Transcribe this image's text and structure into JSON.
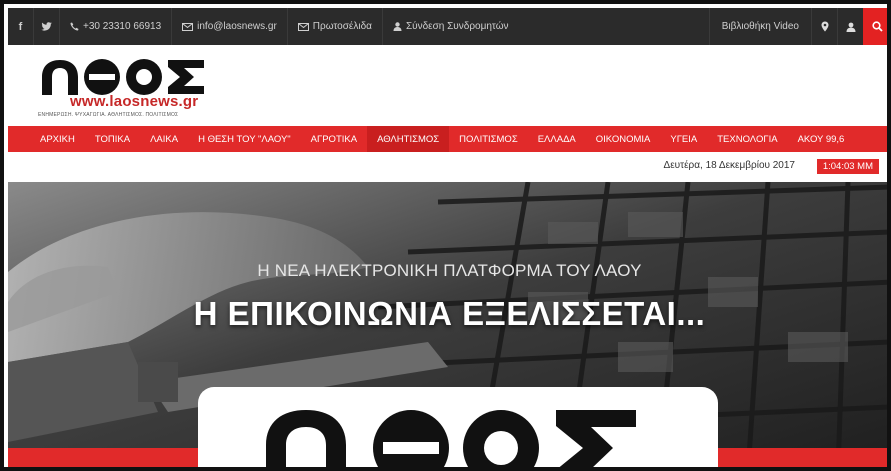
{
  "topbar": {
    "social": [
      {
        "icon": "facebook-icon",
        "glyph": "f"
      },
      {
        "icon": "twitter-icon",
        "glyph": "t"
      }
    ],
    "phone": "+30 23310 66913",
    "email": "info@laosnews.gr",
    "frontpages": "Πρωτοσέλιδα",
    "subscribers_login": "Σύνδεση Συνδρομητών",
    "video_library": "Βιβλιοθήκη Video"
  },
  "header": {
    "logo_text": "ΛΑΟΣ",
    "url": "www.laosnews.gr",
    "tagline": "ΕΝΗΜΕΡΩΣΗ. ΨΥΧΑΓΩΓΙΑ. ΑΘΛΗΤΙΣΜΟΣ. ΠΟΛΙΤΙΣΜΟΣ"
  },
  "nav": {
    "items": [
      "ΑΡΧΙΚΗ",
      "ΤΟΠΙΚΑ",
      "ΛΑΙΚΑ",
      "Η ΘΕΣΗ ΤΟΥ \"ΛΑΟΥ\"",
      "ΑΓΡΟΤΙΚΑ",
      "ΑΘΛΗΤΙΣΜΟΣ",
      "ΠΟΛΙΤΙΣΜΟΣ",
      "ΕΛΛΑΔΑ",
      "ΟΙΚΟΝΟΜΙΑ",
      "ΥΓΕΙΑ",
      "ΤΕΧΝΟΛΟΓΙΑ",
      "ΑΚΟΥ 99,6"
    ],
    "active_index": 5
  },
  "datebar": {
    "date": "Δευτέρα, 18 Δεκεμβρίου 2017",
    "time": "1:04:03 ΜΜ"
  },
  "hero": {
    "subtitle": "Η ΝΕΑ ΗΛΕΚΤΡΟΝΙΚΗ ΠΛΑΤΦΟΡΜΑ ΤΟΥ ΛΑΟΥ",
    "title": "Η ΕΠΙΚΟΙΝΩΝΙΑ ΕΞΕΛΙΣΣΕΤΑΙ..."
  },
  "colors": {
    "accent": "#e12a2a",
    "topbar": "#2b2b2b"
  }
}
